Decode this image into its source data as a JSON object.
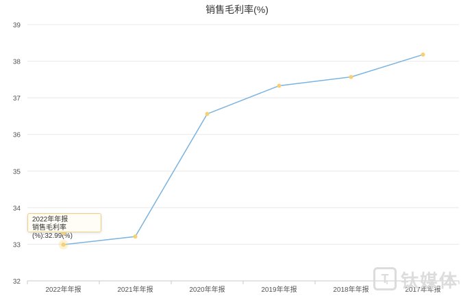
{
  "chart_data": {
    "type": "line",
    "title": "销售毛利率(%)",
    "categories": [
      "2022年年报",
      "2021年年报",
      "2020年年报",
      "2019年年报",
      "2018年年报",
      "2017年年报"
    ],
    "series": [
      {
        "values": [
          32.99,
          33.21,
          36.56,
          37.33,
          37.57,
          38.18
        ]
      }
    ],
    "ylim": [
      32,
      39
    ],
    "yticks": [
      32,
      33,
      34,
      35,
      36,
      37,
      38,
      39
    ],
    "grid": true,
    "line_color": "#7ab3e0",
    "point_color": "#f8cf72"
  },
  "tooltip": {
    "title": "2022年年报",
    "value_text": "销售毛利率(%):32.99(%)"
  },
  "watermark": {
    "logo_glyph": "T",
    "text": "钛媒体"
  }
}
